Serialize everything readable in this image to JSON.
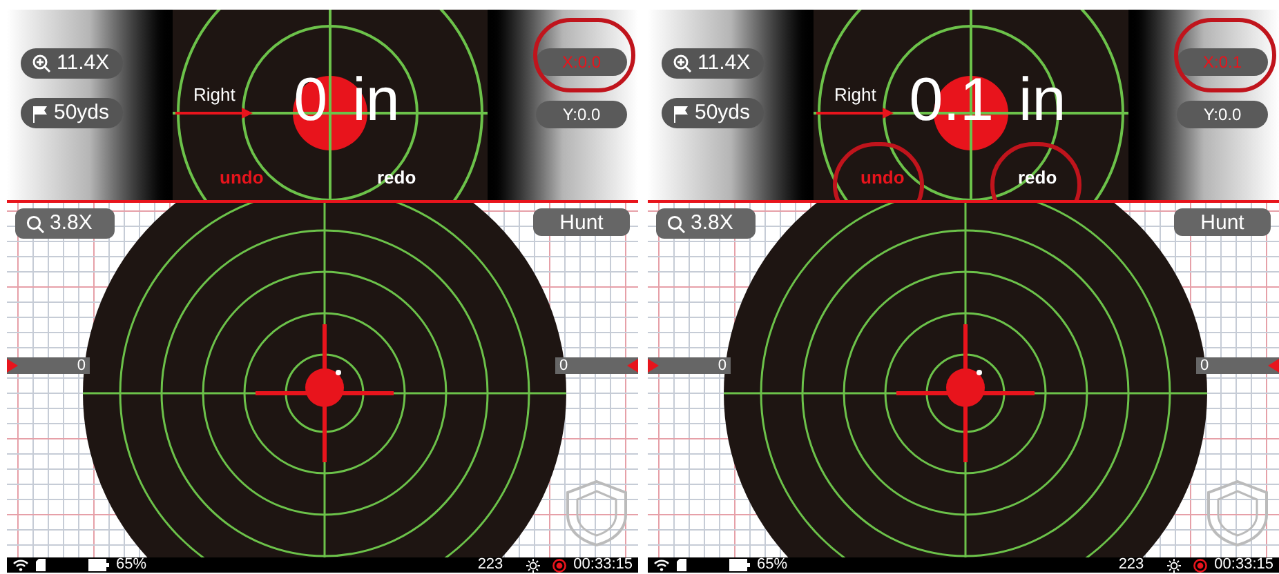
{
  "screens": [
    {
      "zoom_top": "11.4X",
      "distance": "50yds",
      "direction": "Right",
      "offset_value": "0",
      "offset_unit": "in",
      "actions": [
        {
          "kind": "undo",
          "label": "undo",
          "circled": false
        },
        {
          "kind": "redo",
          "label": "redo",
          "circled": false
        }
      ],
      "x_offset": {
        "label": "X:0.0",
        "circled": true
      },
      "y_offset": "Y:0.0",
      "zoom_bottom": "3.8X",
      "mode": "Hunt",
      "left_scale": "0",
      "right_scale": "0",
      "status": {
        "battery": "65%",
        "count": "223",
        "time": "00:33:15"
      }
    },
    {
      "zoom_top": "11.4X",
      "distance": "50yds",
      "direction": "Right",
      "offset_value": "0.1",
      "offset_unit": "in",
      "actions": [
        {
          "kind": "undo",
          "label": "undo",
          "circled": true
        },
        {
          "kind": "redo",
          "label": "redo",
          "circled": true
        }
      ],
      "x_offset": {
        "label": "X:0.1",
        "circled": true
      },
      "y_offset": "Y:0.0",
      "zoom_bottom": "3.8X",
      "mode": "Hunt",
      "left_scale": "0",
      "right_scale": "0",
      "status": {
        "battery": "65%",
        "count": "223",
        "time": "00:33:15"
      }
    }
  ]
}
